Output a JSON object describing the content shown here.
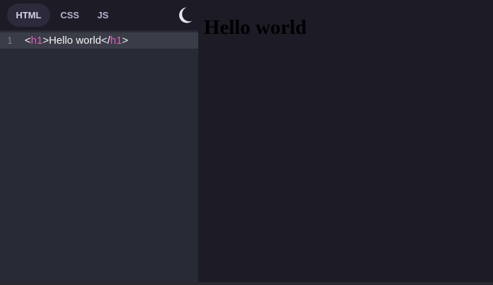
{
  "tabs": [
    {
      "label": "HTML",
      "active": true
    },
    {
      "label": "CSS",
      "active": false
    },
    {
      "label": "JS",
      "active": false
    }
  ],
  "theme_toggle": {
    "icon": "moon-icon"
  },
  "editor": {
    "line_number": "1",
    "code": {
      "open_bracket": "<",
      "open_tag": "h1",
      "open_close_bracket": ">",
      "content": "Hello world",
      "close_open_bracket": "</",
      "close_tag": "h1",
      "close_bracket": ">"
    }
  },
  "preview": {
    "heading": "Hello world"
  },
  "colors": {
    "editor_bg": "#282a36",
    "app_bg": "#1d1b26",
    "active_line_bg": "#3a3d48",
    "tag_color": "#e15fb4",
    "tab_active_bg": "#2c2a3b",
    "tab_text": "#b7b2cf"
  }
}
